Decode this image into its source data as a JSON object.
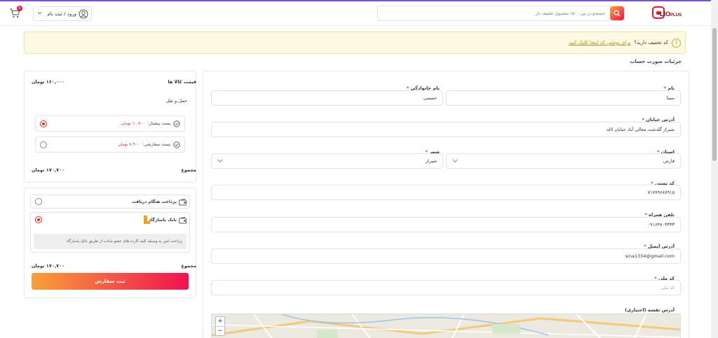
{
  "header": {
    "logo_text": "LIO",
    "logo_sub": "PLUS",
    "search_placeholder": "جستجو در بین ۱۵۰۰ محصول تخفیف دار",
    "login_label": "ورود / ثبت نام",
    "cart_count": "0"
  },
  "coupon": {
    "question": "کد تخفیف دارید؟",
    "link": "برای نوشتن کد اینجا کلیک کنید"
  },
  "billing": {
    "title": "جزئیات صورت حساب",
    "first_name_label": "نام",
    "first_name_value": "سینا",
    "last_name_label": "نام خانوادگی",
    "last_name_value": "حسینی",
    "street_label": "آدرس خیابان",
    "street_value": "شیراز گلدشت معالی آباد خیابان لاله",
    "state_label": "استان",
    "state_value": "فارس",
    "city_label": "شهر",
    "city_value": "شیراز",
    "postcode_label": "کد پستی",
    "postcode_value": "۷۱۷۷۹۶۸۷۹۱۵",
    "phone_label": "تلفن همراه",
    "phone_value": "۰۹۱۶۴۷۰۳۳۳۳",
    "email_label": "آدرس ایمیل",
    "email_value": "sina1334@gmail.com",
    "national_id_label": "کد ملی",
    "national_id_placeholder": "کد ملی",
    "map_label": "آدرس نقشه (اختیاری)",
    "zoom_in": "+",
    "zoom_out": "−",
    "required_mark": "*"
  },
  "summary": {
    "items_label": "قیمت کالا ها",
    "items_value": "۱۶۰,۰۰۰ تومان",
    "shipping_label": "حمل و نقل",
    "ship_options": [
      {
        "name": "پست پیشتاز:",
        "price": "۱۰,۷۰۰ تومان",
        "selected": true
      },
      {
        "name": "پست سفارشی:",
        "price": "۷,۹۰۰ تومان",
        "selected": false
      }
    ],
    "total_label": "مجموع",
    "total_value": "۱۷۰,۷۰۰ تومان"
  },
  "payment": {
    "cod_label": "پرداخت هنگام دریافت",
    "bank_label": "بانک پاسارگاد",
    "bank_desc": "پرداخت امن به وسیله کلیه کارت های عضو شتاب از طریق بانک پاسارگاد",
    "total_label": "مجموع",
    "total_value": "۱۷۰,۷۰۰ تومان",
    "submit_label": "ثبت سفارش"
  },
  "colors": {
    "accent": "#f0124f",
    "accent2": "#f8a03a",
    "required": "#e02b2b",
    "notice_bg": "#fdf9e3"
  }
}
